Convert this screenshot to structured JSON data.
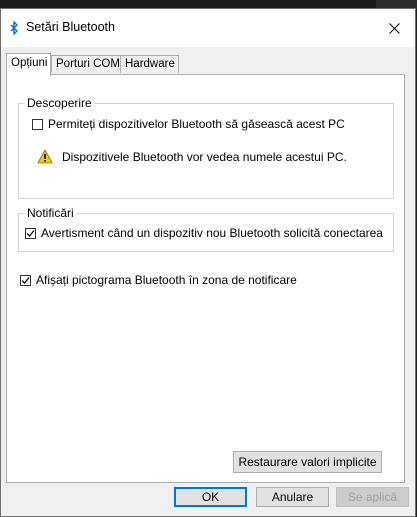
{
  "window": {
    "title": "Setări Bluetooth",
    "title_icon": "bluetooth-icon",
    "close_icon": "close-icon"
  },
  "tabs": [
    {
      "label": "Opțiuni",
      "active": true
    },
    {
      "label": "Porturi COM",
      "active": false
    },
    {
      "label": "Hardware",
      "active": false
    }
  ],
  "discovery": {
    "group_label": "Descoperire",
    "allow_label": "Permiteți dispozitivelor Bluetooth să găsească acest PC",
    "allow_checked": false,
    "warning_icon": "warning-icon",
    "warning_text": "Dispozitivele Bluetooth vor vedea numele acestui PC."
  },
  "notifications": {
    "group_label": "Notificări",
    "alert_label": "Avertisment când un dispozitiv nou Bluetooth solicită conectarea",
    "alert_checked": true
  },
  "tray": {
    "label": "Afișați pictograma Bluetooth în zona de notificare",
    "checked": true
  },
  "buttons": {
    "restore": "Restaurare valori implicite",
    "ok": "OK",
    "cancel": "Anulare",
    "apply": "Se aplică"
  },
  "colors": {
    "accent": "#0078d7",
    "warning": "#f2c811"
  }
}
